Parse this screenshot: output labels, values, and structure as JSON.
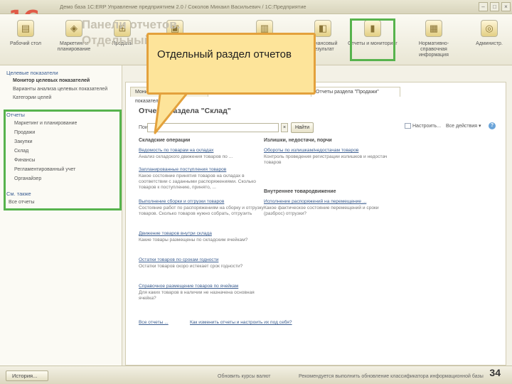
{
  "window": {
    "title": "Демо база 1С:ERP Управление предприятием 2.0 / Соколов Михаил Васильевич / 1С:Предприятие",
    "logo": "1C"
  },
  "slide": {
    "title_line1": "Панели отчетов.",
    "title_line2": "Отдельный"
  },
  "sections": [
    {
      "label": "Рабочий стол",
      "icon": "desktop-icon"
    },
    {
      "label": "Маркетинг и планирование",
      "icon": "marketing-icon"
    },
    {
      "label": "Продажи",
      "icon": "sales-icon"
    },
    {
      "label": "",
      "icon": "purchases-icon"
    },
    {
      "label": "",
      "icon": "warehouse-icon"
    },
    {
      "label": "Финансовый результат",
      "icon": "finance-icon"
    },
    {
      "label": "Отчеты и мониторинг",
      "icon": "reports-icon"
    },
    {
      "label": "Нормативно-справочная информация",
      "icon": "reference-icon"
    },
    {
      "label": "Администр.",
      "icon": "admin-icon"
    }
  ],
  "sidebar": {
    "targets_header": "Целевые показатели",
    "targets_items": [
      "Монитор целевых показателей",
      "Варианты анализа целевых показателей",
      "Категории целей"
    ],
    "reports_header": "Отчеты",
    "reports_items": [
      "Маркетинг и планирование",
      "Продажи",
      "Закупки",
      "Склад",
      "Финансы",
      "Регламентированный учет",
      "Органайзер"
    ],
    "see_also_header": "См. также",
    "see_also_items": [
      "Все отчеты"
    ]
  },
  "tabs": [
    "Монитор целевых показателей",
    "Отчеты раздела \"Продажи\""
  ],
  "panel": {
    "title": "Отчеты раздела \"Склад\"",
    "search_label": "Поиск:",
    "search_value": "",
    "clear_symbol": "×",
    "find_label": "Найти",
    "configure_label": "Настроить...",
    "all_actions_label": "Все действия ▾",
    "help_symbol": "?"
  },
  "callout": {
    "text": "Отдельный раздел отчетов"
  },
  "left_column": {
    "header": "Складские операции",
    "reports": [
      {
        "link": "Ведомость по товарам на складах",
        "desc": "Анализ складского движения товаров по ..."
      },
      {
        "link": "Запланированные поступления товаров",
        "desc": "Какое состояние принятия товаров на складах в соответствии с заданными распоряжениями. Сколько товаров к поступлению, принято, ..."
      },
      {
        "link": "Выполнение сборки и отгрузки товаров",
        "desc": "Состояние работ по распоряжениям на сборку и отгрузку товаров. Сколько товаров нужно собрать, отгрузить"
      },
      {
        "link": "Движение товаров внутри склада",
        "desc": "Какие товары размещены по складским ячейкам?"
      },
      {
        "link": "Остатки товаров по срокам годности",
        "desc": "Остатки товаров скоро истекает срок годности?"
      },
      {
        "link": "Справочное размещение товаров по ячейкам",
        "desc": "Для каких товаров в наличии не назначена основная ячейка?"
      }
    ],
    "all_reports_link": "Все отчеты ..."
  },
  "right_column": {
    "header1": "Излишки, недостачи, порчи",
    "reports1": [
      {
        "link": "Обороты по излишкам/недостачам товаров",
        "desc": "Контроль проведения регистрации излишков и недостач товаров"
      }
    ],
    "header2": "Внутреннее товародвижение",
    "reports2": [
      {
        "link": "Исполнение распоряжений на перемещение ...",
        "desc": "Какое фактическое состояние перемещений и сроки (разброс) отгрузки?"
      }
    ],
    "how_to_link": "Как изменить отчеты и настроить их под себя?"
  },
  "status": {
    "history_label": "История...",
    "text1": "Обновить курсы валют",
    "text2": "Рекомендуется выполнить обновление классификатора информационной базы",
    "page_number": "34"
  },
  "colors": {
    "highlight": "#57b34d",
    "callout_fill": "#fde49a",
    "callout_border": "#e3a13c",
    "link": "#3b5d8f"
  }
}
